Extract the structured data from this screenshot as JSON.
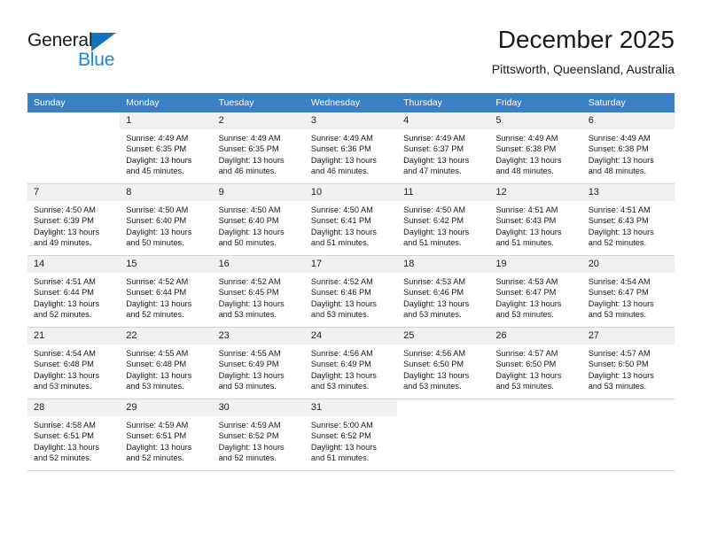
{
  "brand": {
    "name_top": "General",
    "name_bottom": "Blue",
    "triangle_color": "#1473bd",
    "blue_color": "#1f84d6"
  },
  "header": {
    "title": "December 2025",
    "location": "Pittsworth, Queensland, Australia"
  },
  "theme": {
    "header_row_bg": "#3b7fc4",
    "daynum_bg": "#f1f1f1",
    "row_divider": "#d4d4d4",
    "text": "#1a1a1a"
  },
  "columns": [
    "Sunday",
    "Monday",
    "Tuesday",
    "Wednesday",
    "Thursday",
    "Friday",
    "Saturday"
  ],
  "labels": {
    "sunrise_prefix": "Sunrise:",
    "sunset_prefix": "Sunset:",
    "daylight_prefix": "Daylight:"
  },
  "weeks": [
    [
      {
        "day": "",
        "blank": true
      },
      {
        "day": "1",
        "sunrise": "Sunrise: 4:49 AM",
        "sunset": "Sunset: 6:35 PM",
        "daylight_line1": "Daylight: 13 hours",
        "daylight_line2": "and 45 minutes."
      },
      {
        "day": "2",
        "sunrise": "Sunrise: 4:49 AM",
        "sunset": "Sunset: 6:35 PM",
        "daylight_line1": "Daylight: 13 hours",
        "daylight_line2": "and 46 minutes."
      },
      {
        "day": "3",
        "sunrise": "Sunrise: 4:49 AM",
        "sunset": "Sunset: 6:36 PM",
        "daylight_line1": "Daylight: 13 hours",
        "daylight_line2": "and 46 minutes."
      },
      {
        "day": "4",
        "sunrise": "Sunrise: 4:49 AM",
        "sunset": "Sunset: 6:37 PM",
        "daylight_line1": "Daylight: 13 hours",
        "daylight_line2": "and 47 minutes."
      },
      {
        "day": "5",
        "sunrise": "Sunrise: 4:49 AM",
        "sunset": "Sunset: 6:38 PM",
        "daylight_line1": "Daylight: 13 hours",
        "daylight_line2": "and 48 minutes."
      },
      {
        "day": "6",
        "sunrise": "Sunrise: 4:49 AM",
        "sunset": "Sunset: 6:38 PM",
        "daylight_line1": "Daylight: 13 hours",
        "daylight_line2": "and 48 minutes."
      }
    ],
    [
      {
        "day": "7",
        "sunrise": "Sunrise: 4:50 AM",
        "sunset": "Sunset: 6:39 PM",
        "daylight_line1": "Daylight: 13 hours",
        "daylight_line2": "and 49 minutes."
      },
      {
        "day": "8",
        "sunrise": "Sunrise: 4:50 AM",
        "sunset": "Sunset: 6:40 PM",
        "daylight_line1": "Daylight: 13 hours",
        "daylight_line2": "and 50 minutes."
      },
      {
        "day": "9",
        "sunrise": "Sunrise: 4:50 AM",
        "sunset": "Sunset: 6:40 PM",
        "daylight_line1": "Daylight: 13 hours",
        "daylight_line2": "and 50 minutes."
      },
      {
        "day": "10",
        "sunrise": "Sunrise: 4:50 AM",
        "sunset": "Sunset: 6:41 PM",
        "daylight_line1": "Daylight: 13 hours",
        "daylight_line2": "and 51 minutes."
      },
      {
        "day": "11",
        "sunrise": "Sunrise: 4:50 AM",
        "sunset": "Sunset: 6:42 PM",
        "daylight_line1": "Daylight: 13 hours",
        "daylight_line2": "and 51 minutes."
      },
      {
        "day": "12",
        "sunrise": "Sunrise: 4:51 AM",
        "sunset": "Sunset: 6:43 PM",
        "daylight_line1": "Daylight: 13 hours",
        "daylight_line2": "and 51 minutes."
      },
      {
        "day": "13",
        "sunrise": "Sunrise: 4:51 AM",
        "sunset": "Sunset: 6:43 PM",
        "daylight_line1": "Daylight: 13 hours",
        "daylight_line2": "and 52 minutes."
      }
    ],
    [
      {
        "day": "14",
        "sunrise": "Sunrise: 4:51 AM",
        "sunset": "Sunset: 6:44 PM",
        "daylight_line1": "Daylight: 13 hours",
        "daylight_line2": "and 52 minutes."
      },
      {
        "day": "15",
        "sunrise": "Sunrise: 4:52 AM",
        "sunset": "Sunset: 6:44 PM",
        "daylight_line1": "Daylight: 13 hours",
        "daylight_line2": "and 52 minutes."
      },
      {
        "day": "16",
        "sunrise": "Sunrise: 4:52 AM",
        "sunset": "Sunset: 6:45 PM",
        "daylight_line1": "Daylight: 13 hours",
        "daylight_line2": "and 53 minutes."
      },
      {
        "day": "17",
        "sunrise": "Sunrise: 4:52 AM",
        "sunset": "Sunset: 6:46 PM",
        "daylight_line1": "Daylight: 13 hours",
        "daylight_line2": "and 53 minutes."
      },
      {
        "day": "18",
        "sunrise": "Sunrise: 4:53 AM",
        "sunset": "Sunset: 6:46 PM",
        "daylight_line1": "Daylight: 13 hours",
        "daylight_line2": "and 53 minutes."
      },
      {
        "day": "19",
        "sunrise": "Sunrise: 4:53 AM",
        "sunset": "Sunset: 6:47 PM",
        "daylight_line1": "Daylight: 13 hours",
        "daylight_line2": "and 53 minutes."
      },
      {
        "day": "20",
        "sunrise": "Sunrise: 4:54 AM",
        "sunset": "Sunset: 6:47 PM",
        "daylight_line1": "Daylight: 13 hours",
        "daylight_line2": "and 53 minutes."
      }
    ],
    [
      {
        "day": "21",
        "sunrise": "Sunrise: 4:54 AM",
        "sunset": "Sunset: 6:48 PM",
        "daylight_line1": "Daylight: 13 hours",
        "daylight_line2": "and 53 minutes."
      },
      {
        "day": "22",
        "sunrise": "Sunrise: 4:55 AM",
        "sunset": "Sunset: 6:48 PM",
        "daylight_line1": "Daylight: 13 hours",
        "daylight_line2": "and 53 minutes."
      },
      {
        "day": "23",
        "sunrise": "Sunrise: 4:55 AM",
        "sunset": "Sunset: 6:49 PM",
        "daylight_line1": "Daylight: 13 hours",
        "daylight_line2": "and 53 minutes."
      },
      {
        "day": "24",
        "sunrise": "Sunrise: 4:56 AM",
        "sunset": "Sunset: 6:49 PM",
        "daylight_line1": "Daylight: 13 hours",
        "daylight_line2": "and 53 minutes."
      },
      {
        "day": "25",
        "sunrise": "Sunrise: 4:56 AM",
        "sunset": "Sunset: 6:50 PM",
        "daylight_line1": "Daylight: 13 hours",
        "daylight_line2": "and 53 minutes."
      },
      {
        "day": "26",
        "sunrise": "Sunrise: 4:57 AM",
        "sunset": "Sunset: 6:50 PM",
        "daylight_line1": "Daylight: 13 hours",
        "daylight_line2": "and 53 minutes."
      },
      {
        "day": "27",
        "sunrise": "Sunrise: 4:57 AM",
        "sunset": "Sunset: 6:50 PM",
        "daylight_line1": "Daylight: 13 hours",
        "daylight_line2": "and 53 minutes."
      }
    ],
    [
      {
        "day": "28",
        "sunrise": "Sunrise: 4:58 AM",
        "sunset": "Sunset: 6:51 PM",
        "daylight_line1": "Daylight: 13 hours",
        "daylight_line2": "and 52 minutes."
      },
      {
        "day": "29",
        "sunrise": "Sunrise: 4:59 AM",
        "sunset": "Sunset: 6:51 PM",
        "daylight_line1": "Daylight: 13 hours",
        "daylight_line2": "and 52 minutes."
      },
      {
        "day": "30",
        "sunrise": "Sunrise: 4:59 AM",
        "sunset": "Sunset: 6:52 PM",
        "daylight_line1": "Daylight: 13 hours",
        "daylight_line2": "and 52 minutes."
      },
      {
        "day": "31",
        "sunrise": "Sunrise: 5:00 AM",
        "sunset": "Sunset: 6:52 PM",
        "daylight_line1": "Daylight: 13 hours",
        "daylight_line2": "and 51 minutes."
      },
      {
        "day": "",
        "blank": true
      },
      {
        "day": "",
        "blank": true
      },
      {
        "day": "",
        "blank": true
      }
    ]
  ]
}
